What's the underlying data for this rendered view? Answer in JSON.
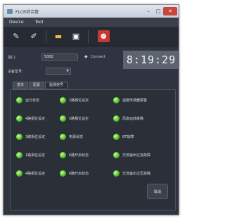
{
  "window": {
    "title": "FLCR综合管"
  },
  "menu": {
    "items": [
      "Device",
      "Tool"
    ]
  },
  "toolbar": {
    "icons": [
      "broom-icon",
      "brush-icon",
      "folder-icon",
      "save-icon",
      "alarm-icon"
    ]
  },
  "connection": {
    "port_label": "端口:",
    "port_value": "5002",
    "connect_label": "Connect",
    "mode_label": "设备型号:",
    "mode_value": ""
  },
  "clock": {
    "time": "8:19:29"
  },
  "tabs": [
    {
      "label": "基本"
    },
    {
      "label": "配置"
    },
    {
      "label": "监测信号"
    }
  ],
  "indicators": [
    "运行状态",
    "2路相位设定",
    "温度传感器报警",
    "4路相位设定",
    "5路相位设定",
    "风扇运转故障",
    "3路相位设定",
    "电源状态",
    "BT故障",
    "1路相位设定",
    "6路开启状态",
    "交流输出过流故障",
    "4路相位设定",
    "6路开启状态",
    "交流输出过压故障"
  ],
  "action": {
    "label": "取消"
  },
  "colors": {
    "led": "#4cbb2a",
    "background": "#2f3440",
    "alarm": "#c43a32"
  }
}
